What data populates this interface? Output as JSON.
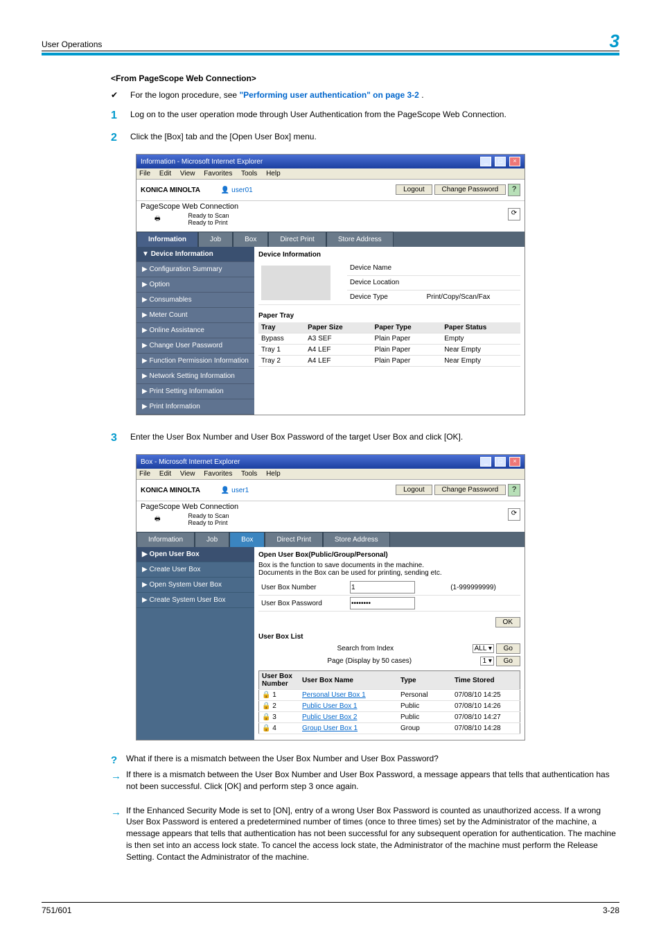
{
  "header": {
    "section": "User Operations",
    "chapter": "3"
  },
  "subhead": "<From PageScope Web Connection>",
  "check": {
    "mark": "✔",
    "textA": "For the logon procedure, see ",
    "link": "\"Performing user authentication\" on page 3-2",
    "textB": "."
  },
  "step1": {
    "num": "1",
    "text": "Log on to the user operation mode through User Authentication from the PageScope Web Connection."
  },
  "step2": {
    "num": "2",
    "text": "Click the [Box] tab and the [Open User Box] menu."
  },
  "step3": {
    "num": "3",
    "text": "Enter the User Box Number and User Box Password of the target User Box and click [OK]."
  },
  "noteQ": {
    "mark": "?",
    "text": "What if there is a mismatch between the User Box Number and User Box Password?"
  },
  "noteA1": {
    "mark": "→",
    "text": "If there is a mismatch between the User Box Number and User Box Password, a message appears that tells that authentication has not been successful. Click [OK] and perform step 3 once again."
  },
  "noteA2": {
    "mark": "→",
    "text": "If the Enhanced Security Mode is set to [ON], entry of a wrong User Box Password is counted as unauthorized access. If a wrong User Box Password is entered a predetermined number of times (once to three times) set by the Administrator of the machine, a message appears that tells that authentication has not been successful for any subsequent operation for authentication. The machine is then set into an access lock state. To cancel the access lock state, the Administrator of the machine must perform the Release Setting. Contact the Administrator of the machine."
  },
  "footer": {
    "left": "751/601",
    "right": "3-28"
  },
  "shot1": {
    "title": "Information - Microsoft Internet Explorer",
    "menu": {
      "file": "File",
      "edit": "Edit",
      "view": "View",
      "fav": "Favorites",
      "tools": "Tools",
      "help": "Help"
    },
    "brand": "KONICA MINOLTA",
    "user": "user01",
    "logout": "Logout",
    "chpw": "Change Password",
    "pswc": "PageScope Web Connection",
    "ready1": "Ready to Scan",
    "ready2": "Ready to Print",
    "tabs": {
      "info": "Information",
      "job": "Job",
      "box": "Box",
      "dp": "Direct Print",
      "sa": "Store Address"
    },
    "side": {
      "di": "Device Information",
      "cs": "Configuration Summary",
      "opt": "Option",
      "cons": "Consumables",
      "mc": "Meter Count",
      "oa": "Online Assistance",
      "cup": "Change User Password",
      "fpi": "Function Permission Information",
      "nsi": "Network Setting Information",
      "psi": "Print Setting Information",
      "pi": "Print Information"
    },
    "main": {
      "secthd": "Device Information",
      "dn": "Device Name",
      "dl": "Device Location",
      "dt": "Device Type",
      "dtv": "Print/Copy/Scan/Fax",
      "pt": "Paper Tray",
      "thTray": "Tray",
      "thSize": "Paper Size",
      "thType": "Paper Type",
      "thStat": "Paper Status",
      "r1": {
        "a": "Bypass",
        "b": "A3 SEF",
        "c": "Plain Paper",
        "d": "Empty"
      },
      "r2": {
        "a": "Tray 1",
        "b": "A4 LEF",
        "c": "Plain Paper",
        "d": "Near Empty"
      },
      "r3": {
        "a": "Tray 2",
        "b": "A4 LEF",
        "c": "Plain Paper",
        "d": "Near Empty"
      }
    }
  },
  "shot2": {
    "title": "Box - Microsoft Internet Explorer",
    "user": "user1",
    "side": {
      "oub": "Open User Box",
      "cub": "Create User Box",
      "osub": "Open System User Box",
      "csub": "Create System User Box"
    },
    "main": {
      "hd": "Open User Box(Public/Group/Personal)",
      "desc1": "Box is the function to save documents in the machine.",
      "desc2": "Documents in the Box can be used for printing, sending etc.",
      "ubn": "User Box Number",
      "ubnv": "1",
      "ubnHint": "(1-999999999)",
      "ubp": "User Box Password",
      "ok": "OK",
      "ubl": "User Box List",
      "sfi": "Search from Index",
      "sfiSel": "ALL",
      "go": "Go",
      "pg": "Page (Display by 50 cases)",
      "pgSel": "1",
      "thNum": "User Box Number",
      "thName": "User Box Name",
      "thType": "Type",
      "thTime": "Time Stored",
      "rows": [
        {
          "n": "1",
          "name": "Personal User Box 1",
          "type": "Personal",
          "time": "07/08/10 14:25"
        },
        {
          "n": "2",
          "name": "Public User Box 1",
          "type": "Public",
          "time": "07/08/10 14:26"
        },
        {
          "n": "3",
          "name": "Public User Box 2",
          "type": "Public",
          "time": "07/08/10 14:27"
        },
        {
          "n": "4",
          "name": "Group User Box 1",
          "type": "Group",
          "time": "07/08/10 14:28"
        }
      ]
    }
  }
}
